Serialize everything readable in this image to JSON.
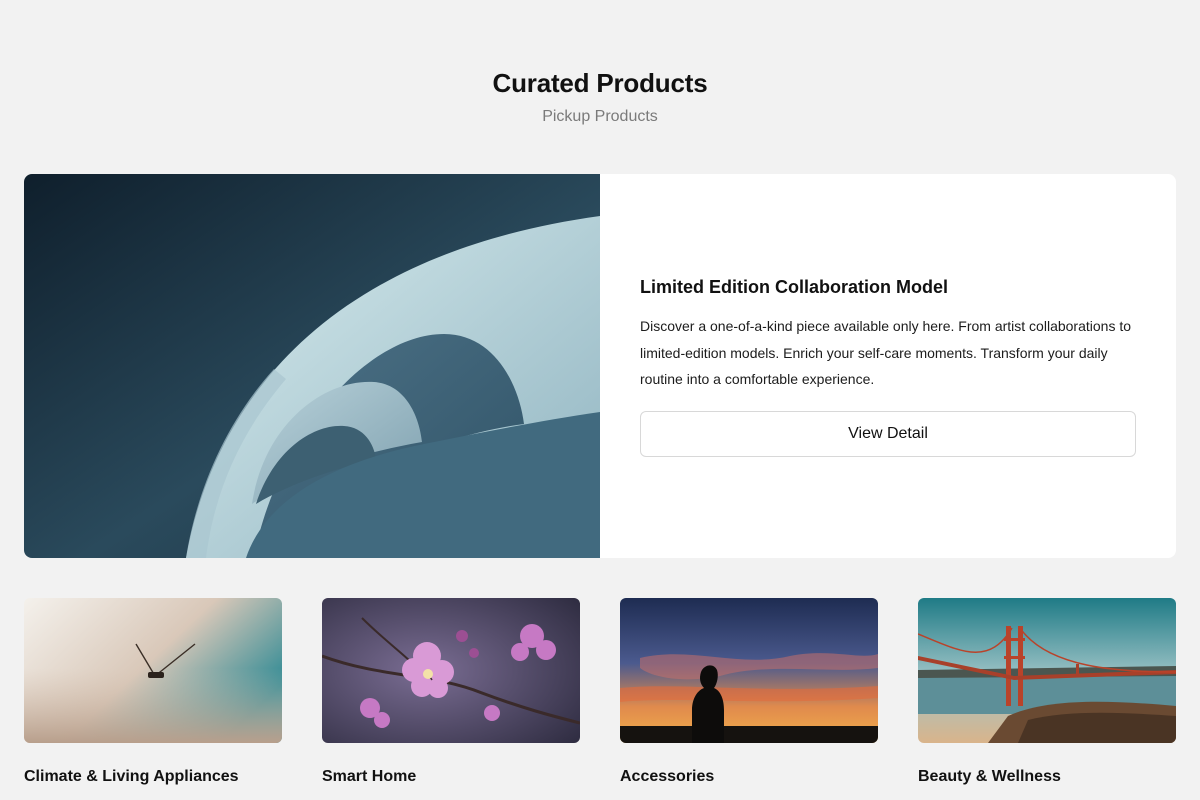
{
  "section": {
    "title": "Curated Products",
    "subtitle": "Pickup Products"
  },
  "featured": {
    "title": "Limited Edition Collaboration Model",
    "description": "Discover a one-of-a-kind piece available only here. From artist collaborations to limited-edition models. Enrich your self-care moments. Transform your daily routine into a comfortable experience.",
    "button_label": "View Detail",
    "image_subject": "spiral-staircase-architecture-photo"
  },
  "categories": [
    {
      "label": "Climate & Living Appliances",
      "image_subject": "misty-landscape-wind-turbine-photo"
    },
    {
      "label": "Smart Home",
      "image_subject": "pink-cherry-blossom-photo"
    },
    {
      "label": "Accessories",
      "image_subject": "silhouette-at-sunset-photo"
    },
    {
      "label": "Beauty & Wellness",
      "image_subject": "golden-gate-bridge-photo"
    }
  ],
  "colors": {
    "background": "#f2f2f2",
    "card": "#ffffff",
    "text": "#111111",
    "muted": "#7a7a7a",
    "border": "#d8d8d8"
  }
}
